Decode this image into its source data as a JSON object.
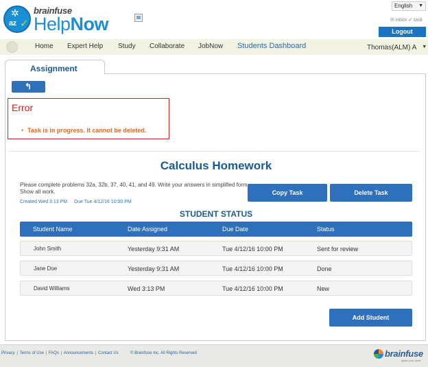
{
  "header": {
    "brand": "brainfuse",
    "product_light": "Help",
    "product_bold": "Now",
    "language": "English",
    "inbox_label": "inbox",
    "task_label": "task",
    "logout_label": "Logout"
  },
  "nav": {
    "items": [
      "Home",
      "Expert Help",
      "Study",
      "Collaborate",
      "JobNow",
      "Students Dashboard"
    ],
    "user": "Thomas(ALM) A"
  },
  "tab": {
    "label": "Assignment"
  },
  "back": {
    "glyph": "↰"
  },
  "error": {
    "title": "Error",
    "message": "Task is in progress. It cannot be deleted."
  },
  "task": {
    "title": "Calculus Homework",
    "description": "Please complete problems 32a, 32b, 37, 40, 41, and 49. Write your answers in simplified form. Show all work.",
    "created": "Created Wed 3:13 PM",
    "due": "Due Tue 4/12/16 10:00 PM",
    "copy_label": "Copy Task",
    "delete_label": "Delete Task"
  },
  "status": {
    "title": "STUDENT STATUS",
    "columns": [
      "Student Name",
      "Date Assigned",
      "Due Date",
      "Status"
    ],
    "rows": [
      {
        "name": "John Smith",
        "assigned": "Yesterday 9:31 AM",
        "due": "Tue 4/12/16 10:00 PM",
        "status": "Sent for review"
      },
      {
        "name": "Jane Doe",
        "assigned": "Yesterday 9:31 AM",
        "due": "Tue 4/12/16 10:00 PM",
        "status": "Done"
      },
      {
        "name": "David Williams",
        "assigned": "Wed 3:13 PM",
        "due": "Tue 4/12/16 10:00 PM",
        "status": "New"
      }
    ],
    "add_label": "Add Student"
  },
  "footer": {
    "links": [
      "Privacy",
      "Terms of Use",
      "FAQs",
      "Announcements",
      "Contact Us"
    ],
    "copyright": "© Brainfuse Inc. All Rights Reserved",
    "logo_word": "brainfuse",
    "logo_tag": "ignite your mind"
  },
  "colors": {
    "primary": "#2f70bd",
    "heading": "#1b5b94",
    "error": "#cc2222",
    "error_text": "#e06a1a",
    "nav_bg": "#f3f3e4"
  }
}
